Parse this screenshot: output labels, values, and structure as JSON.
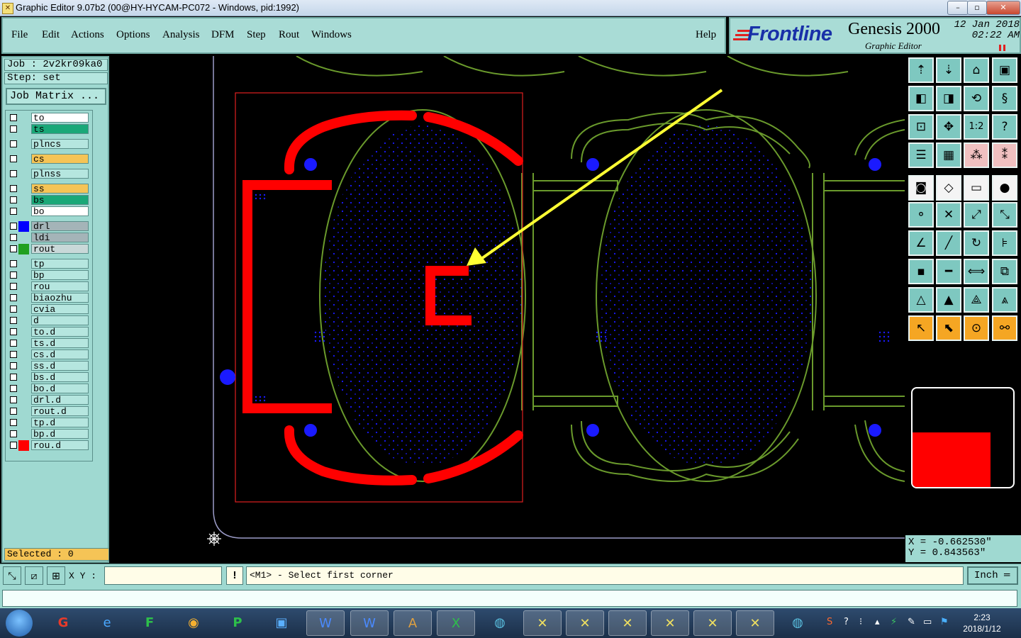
{
  "window": {
    "title": "Graphic Editor 9.07b2 (00@HY-HYCAM-PC072 - Windows, pid:1992)",
    "controls": [
      "–",
      "▫",
      "✕"
    ]
  },
  "menu": {
    "items": [
      "File",
      "Edit",
      "Actions",
      "Options",
      "Analysis",
      "DFM",
      "Step",
      "Rout",
      "Windows"
    ],
    "help": "Help"
  },
  "brand": {
    "logo": "Frontline",
    "product": "Genesis 2000",
    "subtitle": "Graphic Editor",
    "date": "12 Jan 2018",
    "time": "02:22 AM"
  },
  "job": {
    "job_line": "Job : 2v2kr09ka0",
    "step_line": "Step: set",
    "matrix_button": "Job Matrix ..."
  },
  "layers": [
    {
      "name": "to",
      "bg": "#ffffff",
      "swatch": ""
    },
    {
      "name": "ts",
      "bg": "#1aa878",
      "swatch": ""
    },
    {
      "name": "plncs",
      "bg": "#b5e6df",
      "swatch": ""
    },
    {
      "name": "cs",
      "bg": "#f5c456",
      "swatch": ""
    },
    {
      "name": "plnss",
      "bg": "#b5e6df",
      "swatch": ""
    },
    {
      "name": "ss",
      "bg": "#f5c456",
      "swatch": ""
    },
    {
      "name": "bs",
      "bg": "#1aa878",
      "swatch": ""
    },
    {
      "name": "bo",
      "bg": "#ffffff",
      "swatch": ""
    },
    {
      "name": "drl",
      "bg": "#a4b4b8",
      "swatch": "#0000ff"
    },
    {
      "name": "ldi",
      "bg": "#a4b4b8",
      "swatch": ""
    },
    {
      "name": "rout",
      "bg": "#c8d8d8",
      "swatch": "#20a020"
    },
    {
      "name": "tp",
      "bg": "#b5e6df",
      "swatch": ""
    },
    {
      "name": "bp",
      "bg": "#b5e6df",
      "swatch": ""
    },
    {
      "name": "rou",
      "bg": "#b5e6df",
      "swatch": ""
    },
    {
      "name": "biaozhu",
      "bg": "#b5e6df",
      "swatch": ""
    },
    {
      "name": "cvia",
      "bg": "#b5e6df",
      "swatch": ""
    },
    {
      "name": "d",
      "bg": "#b5e6df",
      "swatch": ""
    },
    {
      "name": "to.d",
      "bg": "#b5e6df",
      "swatch": ""
    },
    {
      "name": "ts.d",
      "bg": "#b5e6df",
      "swatch": ""
    },
    {
      "name": "cs.d",
      "bg": "#b5e6df",
      "swatch": ""
    },
    {
      "name": "ss.d",
      "bg": "#b5e6df",
      "swatch": ""
    },
    {
      "name": "bs.d",
      "bg": "#b5e6df",
      "swatch": ""
    },
    {
      "name": "bo.d",
      "bg": "#b5e6df",
      "swatch": ""
    },
    {
      "name": "drl.d",
      "bg": "#b5e6df",
      "swatch": ""
    },
    {
      "name": "rout.d",
      "bg": "#b5e6df",
      "swatch": ""
    },
    {
      "name": "tp.d",
      "bg": "#b5e6df",
      "swatch": ""
    },
    {
      "name": "bp.d",
      "bg": "#b5e6df",
      "swatch": ""
    },
    {
      "name": "rou.d",
      "bg": "#b5e6df",
      "swatch": "#ff0000"
    }
  ],
  "selected": "Selected : 0",
  "coords": {
    "x": "X = -0.662530\"",
    "y": "Y =  0.843563\""
  },
  "command": {
    "xy_label": "X Y :",
    "xy_value": "",
    "warn": "!",
    "prompt": "<M1> - Select first corner",
    "units": "Inch ═"
  },
  "taskbar": {
    "clock_time": "2:23",
    "clock_date": "2018/1/12"
  },
  "colors": {
    "feature_red": "#ff0000",
    "rout_green": "#6a9a2c",
    "drill_blue": "#1a1aff",
    "annotation_yellow": "#ffff33",
    "panel_teal": "#9fd9d1"
  }
}
